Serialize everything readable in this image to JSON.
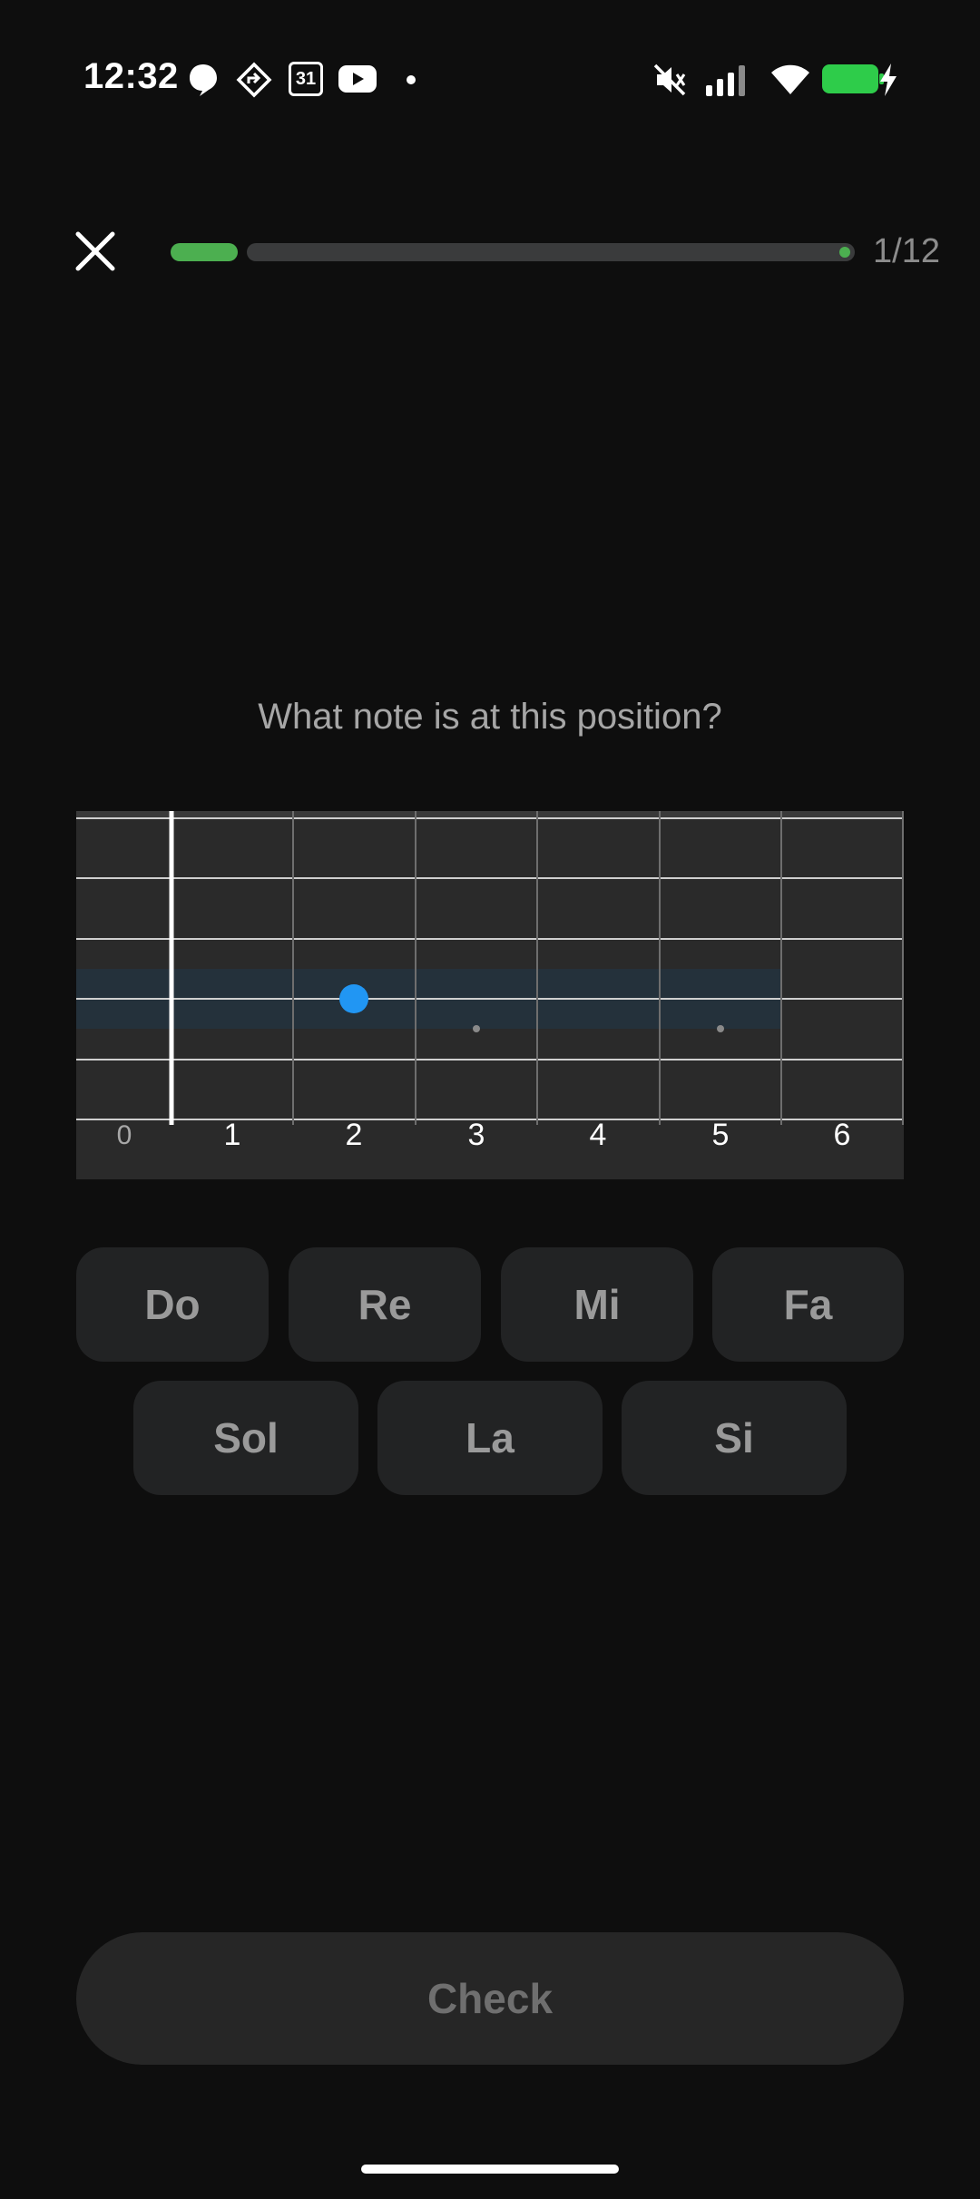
{
  "status_bar": {
    "time": "12:32",
    "left_icons": [
      "threads-icon",
      "maps-icon",
      "calendar-icon",
      "youtube-icon",
      "dot-icon"
    ],
    "calendar_day": "31",
    "right_icons": [
      "mute-icon",
      "signal-icon",
      "wifi-icon",
      "battery-charging-icon"
    ],
    "battery_color": "#2ecc4a"
  },
  "header": {
    "progress_count": "1/12",
    "progress_fraction": 0.0833,
    "progress_color": "#4caf50"
  },
  "question": {
    "text": "What note is at this position?"
  },
  "fretboard": {
    "fret_labels": [
      "0",
      "1",
      "2",
      "3",
      "4",
      "5",
      "6"
    ],
    "selected_string": 3,
    "selected_fret": 2,
    "marker_frets": [
      3,
      5
    ],
    "marker_color": "#2196f3"
  },
  "answers": {
    "row1": [
      "Do",
      "Re",
      "Mi",
      "Fa"
    ],
    "row2": [
      "Sol",
      "La",
      "Si"
    ]
  },
  "footer": {
    "check_label": "Check"
  }
}
